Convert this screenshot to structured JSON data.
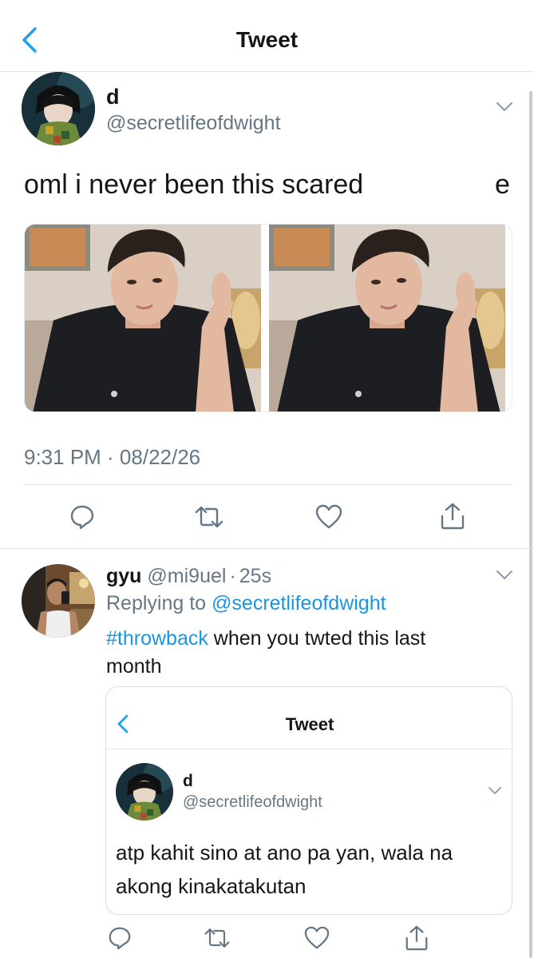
{
  "header": {
    "title": "Tweet"
  },
  "tweet": {
    "name": "d",
    "handle": "@secretlifeofdwight",
    "text": "oml i never been this scared",
    "clipped_text": "e",
    "timestamp": "9:31 PM · 08/22/26"
  },
  "reply": {
    "name": "gyu",
    "handle": "@mi9uel",
    "sep": "·",
    "age": "25s",
    "replying_prefix": "Replying to",
    "replying_handle": "@secretlifeofdwight",
    "hashtag": "#throwback",
    "text_rest": " when you twted this last",
    "text_line2": "month"
  },
  "quoted_screenshot": {
    "title": "Tweet",
    "name": "d",
    "handle": "@secretlifeofdwight",
    "text_line1": "atp kahit sino at ano pa yan, wala na",
    "text_line2": "akong kinakatakutan"
  },
  "icons": {
    "back": "chevron-left-icon",
    "more": "chevron-down-icon",
    "reply": "comment-icon",
    "retweet": "retweet-icon",
    "like": "heart-icon",
    "share": "share-icon"
  },
  "colors": {
    "accent": "#1b95e0",
    "secondary_text": "#657786",
    "divider": "#e1e8ed",
    "icon": "#657786"
  }
}
